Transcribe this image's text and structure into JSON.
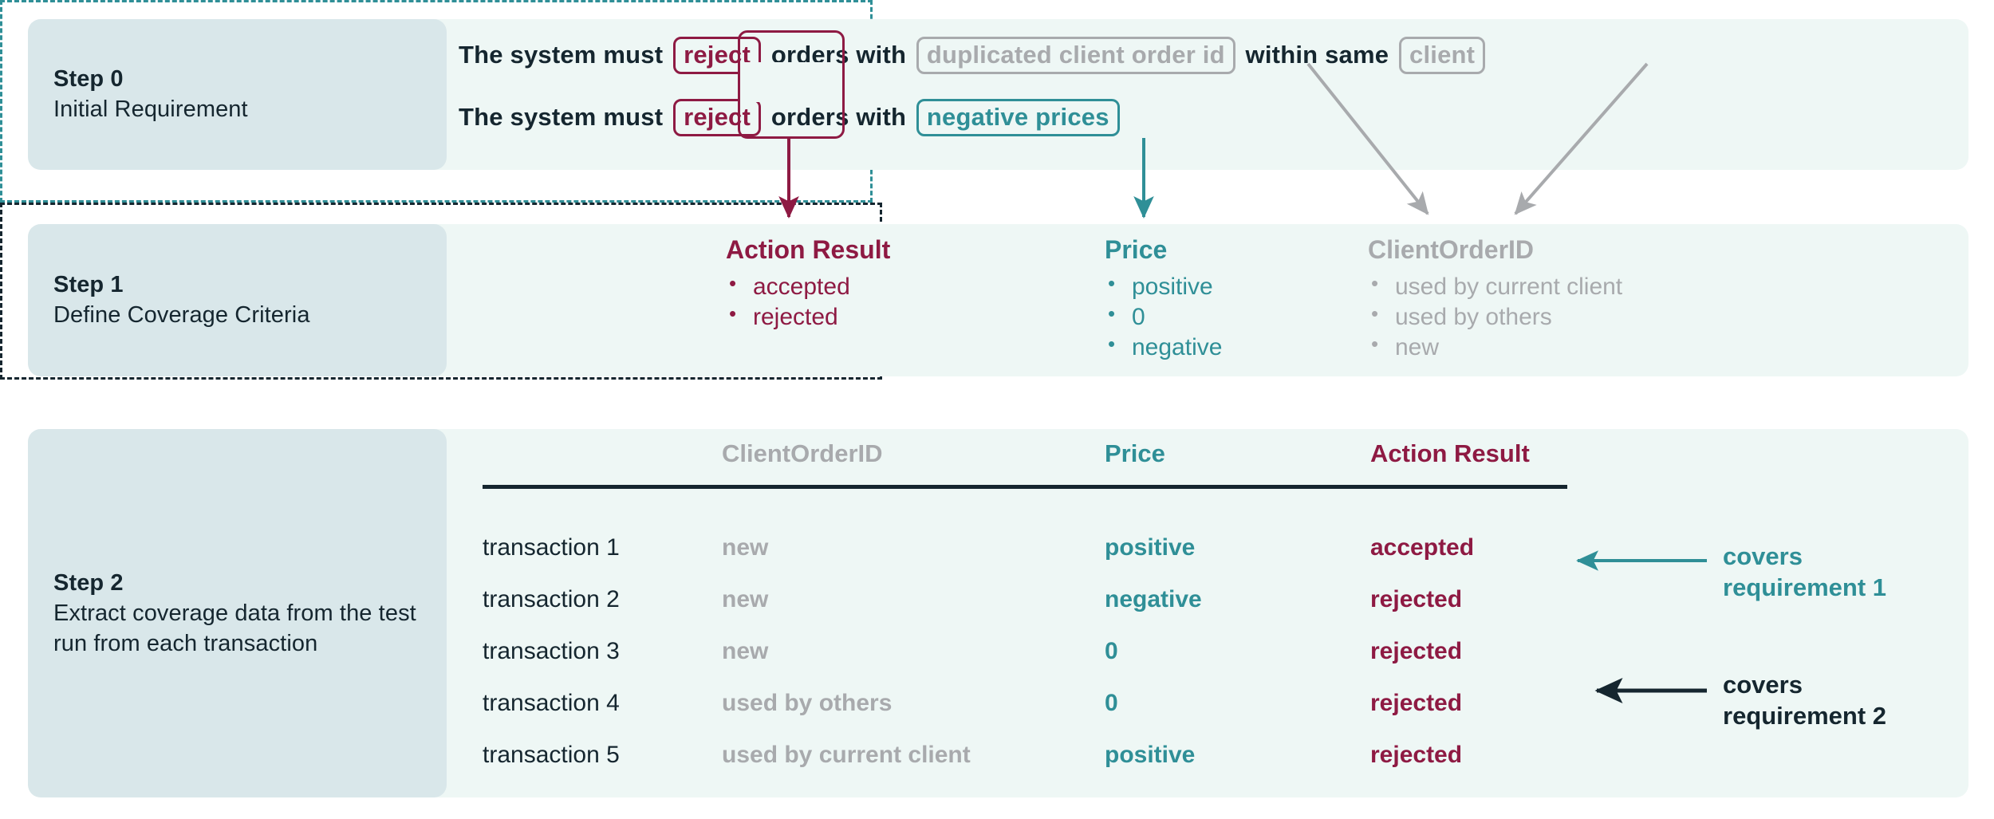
{
  "colors": {
    "panel_label_bg": "#d9e7ea",
    "panel_body_bg": "#eef7f5",
    "ink": "#15262f",
    "crimson": "#8e1a43",
    "teal": "#2f8f97",
    "grey": "#a8aaad"
  },
  "steps": [
    {
      "num": "Step 0",
      "desc": "Initial Requirement"
    },
    {
      "num": "Step 1",
      "desc": "Define Coverage Criteria"
    },
    {
      "num": "Step 2",
      "desc": "Extract coverage data from the test run from each transaction"
    }
  ],
  "step0": {
    "requirements": [
      {
        "parts": [
          {
            "text": "The system must ",
            "style": "plain"
          },
          {
            "text": "reject",
            "style": "chip-reject"
          },
          {
            "text": " orders with ",
            "style": "plain"
          },
          {
            "text": "duplicated client order id",
            "style": "chip-grey"
          },
          {
            "text": " within same ",
            "style": "plain"
          },
          {
            "text": "client",
            "style": "chip-grey"
          }
        ]
      },
      {
        "parts": [
          {
            "text": "The system must ",
            "style": "plain"
          },
          {
            "text": "reject",
            "style": "chip-reject"
          },
          {
            "text": " orders with ",
            "style": "plain"
          },
          {
            "text": "negative prices",
            "style": "chip-teal"
          }
        ]
      }
    ]
  },
  "step1": {
    "criteria": [
      {
        "title": "Action Result",
        "color": "crimson",
        "values": [
          "accepted",
          "rejected"
        ]
      },
      {
        "title": "Price",
        "color": "teal",
        "values": [
          "positive",
          "0",
          "negative"
        ]
      },
      {
        "title": "ClientOrderID",
        "color": "grey",
        "values": [
          "used by current client",
          "used by others",
          "new"
        ]
      }
    ]
  },
  "step2": {
    "columns": [
      "ClientOrderID",
      "Price",
      "Action Result"
    ],
    "row_label_header": "",
    "rows": [
      {
        "label": "transaction 1",
        "clientorderid": "new",
        "price": "positive",
        "action_result": "accepted"
      },
      {
        "label": "transaction 2",
        "clientorderid": "new",
        "price": "negative",
        "action_result": "rejected"
      },
      {
        "label": "transaction 3",
        "clientorderid": "new",
        "price": "0",
        "action_result": "rejected"
      },
      {
        "label": "transaction 4",
        "clientorderid": "used by others",
        "price": "0",
        "action_result": "rejected"
      },
      {
        "label": "transaction 5",
        "clientorderid": "used by current client",
        "price": "positive",
        "action_result": "rejected"
      }
    ],
    "annotations": [
      {
        "line1": "covers",
        "line2": "requirement 1",
        "color": "teal"
      },
      {
        "line1": "covers",
        "line2": "requirement 2",
        "color": "ink"
      }
    ]
  }
}
